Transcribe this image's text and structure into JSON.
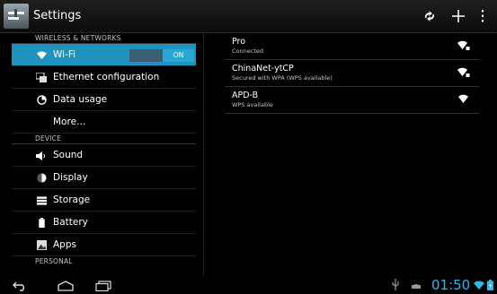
{
  "action_bar": {
    "title": "Settings",
    "icons": [
      "settings-app-icon",
      "wps-pin-icon",
      "add-network-icon",
      "overflow-menu-icon"
    ]
  },
  "sidebar": {
    "sections": [
      {
        "header": "WIRELESS & NETWORKS",
        "items": [
          {
            "label": "Wi-Fi",
            "icon": "wifi-icon",
            "selected": true,
            "toggle": "ON"
          },
          {
            "label": "Ethernet configuration",
            "icon": "ethernet-icon"
          },
          {
            "label": "Data usage",
            "icon": "data-usage-icon"
          },
          {
            "label": "More…",
            "icon": ""
          }
        ]
      },
      {
        "header": "DEVICE",
        "items": [
          {
            "label": "Sound",
            "icon": "sound-icon"
          },
          {
            "label": "Display",
            "icon": "display-icon"
          },
          {
            "label": "Storage",
            "icon": "storage-icon"
          },
          {
            "label": "Battery",
            "icon": "battery-icon"
          },
          {
            "label": "Apps",
            "icon": "apps-icon"
          }
        ]
      },
      {
        "header": "PERSONAL",
        "items": []
      }
    ]
  },
  "networks": [
    {
      "ssid": "Pro",
      "status": "Connected",
      "secured": true
    },
    {
      "ssid": "ChinaNet-ytCP",
      "status": "Secured with WPA (WPS available)",
      "secured": true
    },
    {
      "ssid": "APD-B",
      "status": "WPS available",
      "secured": false
    }
  ],
  "status_bar": {
    "time": "01:50",
    "icons": [
      "usb-icon",
      "android-debug-icon",
      "wifi-signal-icon",
      "battery-charging-icon"
    ]
  },
  "nav_bar": {
    "icons": [
      "back-icon",
      "home-icon",
      "recent-apps-icon"
    ]
  },
  "colors": {
    "accent": "#33b5e5",
    "selected_bg": "#1f93bd",
    "toggle_on": "#2aa6d3"
  }
}
